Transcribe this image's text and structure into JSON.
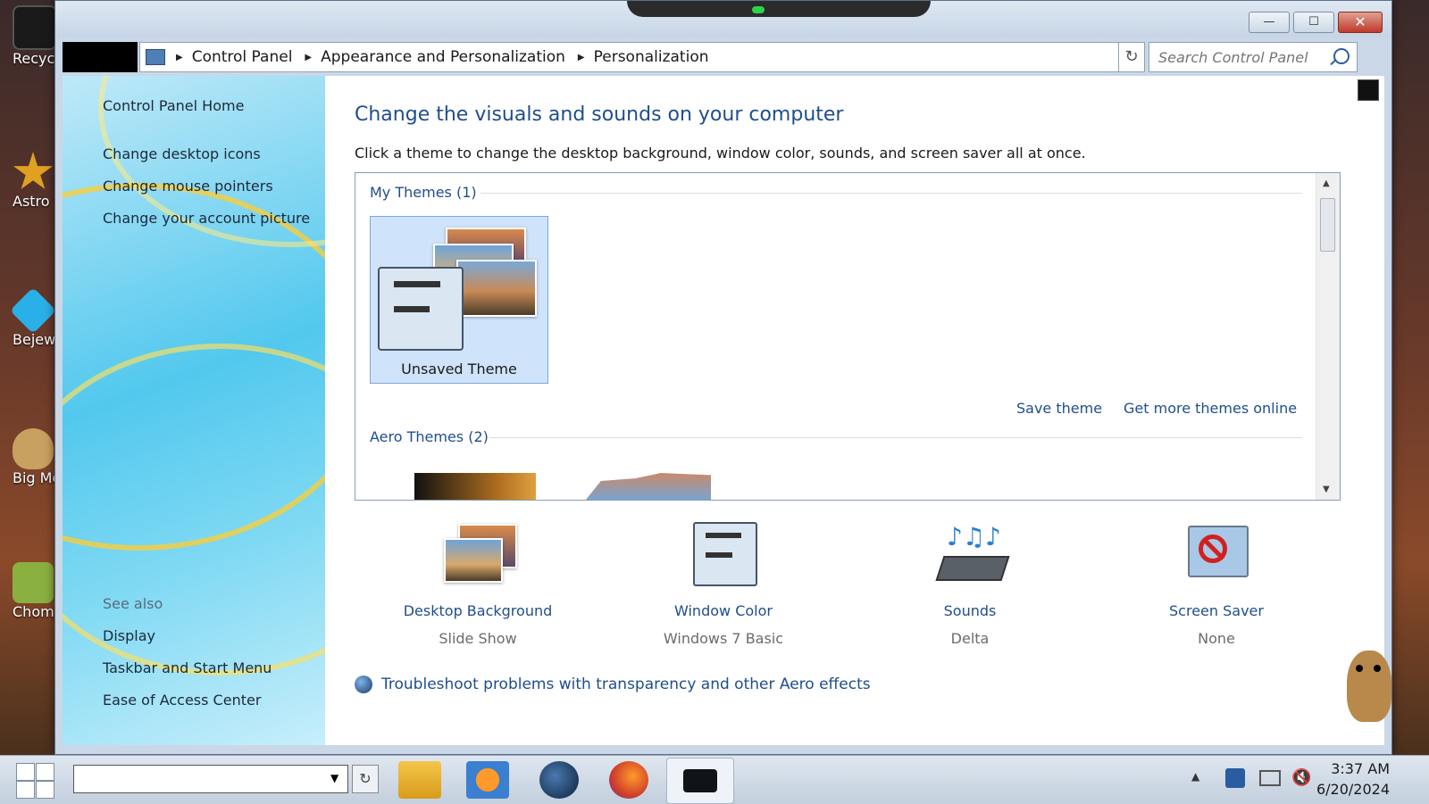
{
  "desktop": {
    "icons": [
      {
        "label": "Recycle Bin",
        "color": "#1a1a1a"
      },
      {
        "label": "Astro Deluxe",
        "color": "#e0a020"
      },
      {
        "label": "Bejeweled Deluxe",
        "color": "#2ab0e8"
      },
      {
        "label": "Big Money Deluxe",
        "color": "#c8a060"
      },
      {
        "label": "Chomp",
        "color": "#8ab040"
      }
    ]
  },
  "window": {
    "controls": {
      "minimize": "—",
      "maximize": "☐",
      "close": "✕"
    },
    "breadcrumb": [
      "Control Panel",
      "Appearance and Personalization",
      "Personalization"
    ],
    "search_placeholder": "Search Control Panel"
  },
  "left_pane": {
    "links": [
      "Control Panel Home",
      "Change desktop icons",
      "Change mouse pointers",
      "Change your account picture"
    ],
    "see_also_label": "See also",
    "see_also": [
      "Display",
      "Taskbar and Start Menu",
      "Ease of Access Center"
    ]
  },
  "main": {
    "heading": "Change the visuals and sounds on your computer",
    "subtext": "Click a theme to change the desktop background, window color, sounds, and screen saver all at once.",
    "my_themes_header": "My Themes (1)",
    "unsaved_theme_label": "Unsaved Theme",
    "save_theme": "Save theme",
    "get_more_themes": "Get more themes online",
    "aero_themes_header": "Aero Themes (2)",
    "settings": [
      {
        "label": "Desktop Background",
        "value": "Slide Show",
        "icon": "desktop-background-icon"
      },
      {
        "label": "Window Color",
        "value": "Windows 7 Basic",
        "icon": "window-color-icon"
      },
      {
        "label": "Sounds",
        "value": "Delta",
        "icon": "sounds-icon"
      },
      {
        "label": "Screen Saver",
        "value": "None",
        "icon": "screen-saver-icon"
      }
    ],
    "troubleshoot_link": "Troubleshoot problems with transparency and other Aero effects"
  },
  "taskbar": {
    "time": "3:37 AM",
    "date": "6/20/2024",
    "show_hidden_icons": "▲"
  },
  "colors": {
    "accent_link": "#1f4e8c",
    "close_button": "#c0392b"
  }
}
